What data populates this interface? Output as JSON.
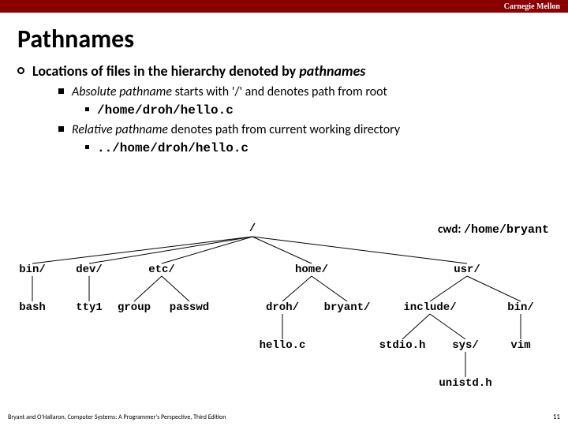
{
  "topbar": "Carnegie Mellon",
  "title": "Pathnames",
  "b1": {
    "pre": "Locations of files in the hierarchy denoted by ",
    "em": "pathnames"
  },
  "b2a": {
    "em": "Absolute pathname",
    "post": " starts with '/' and denotes path from root"
  },
  "b3a": "/home/droh/hello.c",
  "b2b": {
    "em": "Relative pathname",
    "post": " denotes path from current working directory"
  },
  "b3b": "../home/droh/hello.c",
  "cwd": {
    "label": "cwd:",
    "path": "/home/bryant"
  },
  "tree": {
    "root": "/",
    "l1": {
      "bin": "bin/",
      "dev": "dev/",
      "etc": "etc/",
      "home": "home/",
      "usr": "usr/"
    },
    "l2": {
      "bash": "bash",
      "tty1": "tty1",
      "group": "group",
      "passwd": "passwd",
      "droh": "droh/",
      "bryant": "bryant/",
      "include": "include/",
      "ubin": "bin/"
    },
    "l3": {
      "helloc": "hello.c",
      "stdioh": "stdio.h",
      "sys": "sys/",
      "vim": "vim"
    },
    "l4": {
      "unistdh": "unistd.h"
    }
  },
  "footer": "Bryant and O'Hallaron, Computer Systems: A Programmer's Perspective, Third Edition",
  "page": "11"
}
